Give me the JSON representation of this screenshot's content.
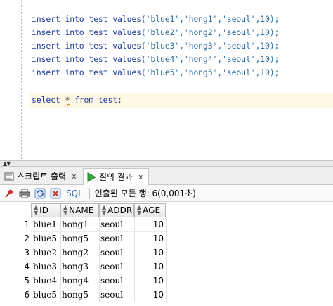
{
  "editor": {
    "lines": [
      {
        "kw1": "insert",
        "kw2": "into",
        "tbl": "test",
        "kw3": "values",
        "vals": "('blue1','hong1','seoul',10);"
      },
      {
        "kw1": "insert",
        "kw2": "into",
        "tbl": "test",
        "kw3": "values",
        "vals": "('blue2','hong2','seoul',10);"
      },
      {
        "kw1": "insert",
        "kw2": "into",
        "tbl": "test",
        "kw3": "values",
        "vals": "('blue3','hong3','seoul',10);"
      },
      {
        "kw1": "insert",
        "kw2": "into",
        "tbl": "test",
        "kw3": "values",
        "vals": "('blue4','hong4','seoul',10);"
      },
      {
        "kw1": "insert",
        "kw2": "into",
        "tbl": "test",
        "kw3": "values",
        "vals": "('blue5','hong5','seoul',10);"
      }
    ],
    "select": {
      "kw1": "select",
      "star": "*",
      "kw2": "from",
      "rest": "test;"
    }
  },
  "tabs": [
    {
      "label": "스크립트 출력",
      "close": "x",
      "icon": "script-output-icon"
    },
    {
      "label": "질의 결과",
      "close": "x",
      "icon": "run-query-icon"
    }
  ],
  "toolbar": {
    "sql_label": "SQL",
    "status": "인출된 모든 행: 6(0,001초)"
  },
  "grid": {
    "columns": [
      "ID",
      "NAME",
      "ADDR",
      "AGE"
    ],
    "rows": [
      {
        "n": "1",
        "id": "blue1",
        "name": "hong1",
        "addr": "seoul",
        "age": "10"
      },
      {
        "n": "2",
        "id": "blue5",
        "name": "hong5",
        "addr": "seoul",
        "age": "10"
      },
      {
        "n": "3",
        "id": "blue2",
        "name": "hong2",
        "addr": "seoul",
        "age": "10"
      },
      {
        "n": "4",
        "id": "blue3",
        "name": "hong3",
        "addr": "seoul",
        "age": "10"
      },
      {
        "n": "5",
        "id": "blue4",
        "name": "hong4",
        "addr": "seoul",
        "age": "10"
      },
      {
        "n": "6",
        "id": "blue5",
        "name": "hong5",
        "addr": "seoul",
        "age": "10"
      }
    ]
  },
  "colors": {
    "keyword": "#1f3c9b",
    "string": "#2c6ea3",
    "highlight": "#fdf7e3"
  }
}
